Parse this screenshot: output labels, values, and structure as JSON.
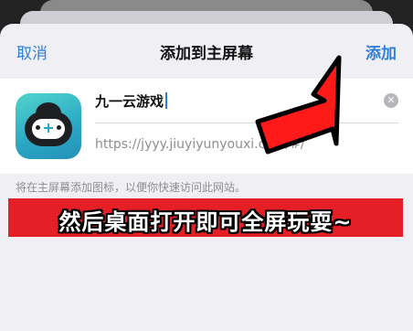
{
  "nav": {
    "cancel_label": "取消",
    "title": "添加到主屏幕",
    "add_label": "添加"
  },
  "app": {
    "name": "九一云游戏",
    "url": "https://jyyy.jiuyiyunyouxi.com/#/",
    "icon": "cloud-gamepad-icon"
  },
  "hint": "将在主屏幕添加图标，以便你快速访问此网站。",
  "banner": {
    "text": "然后桌面打开即可全屏玩耍~",
    "color": "#e41f26"
  },
  "colors": {
    "accent": "#2f7fd8",
    "arrow": "#ff1a1a"
  }
}
